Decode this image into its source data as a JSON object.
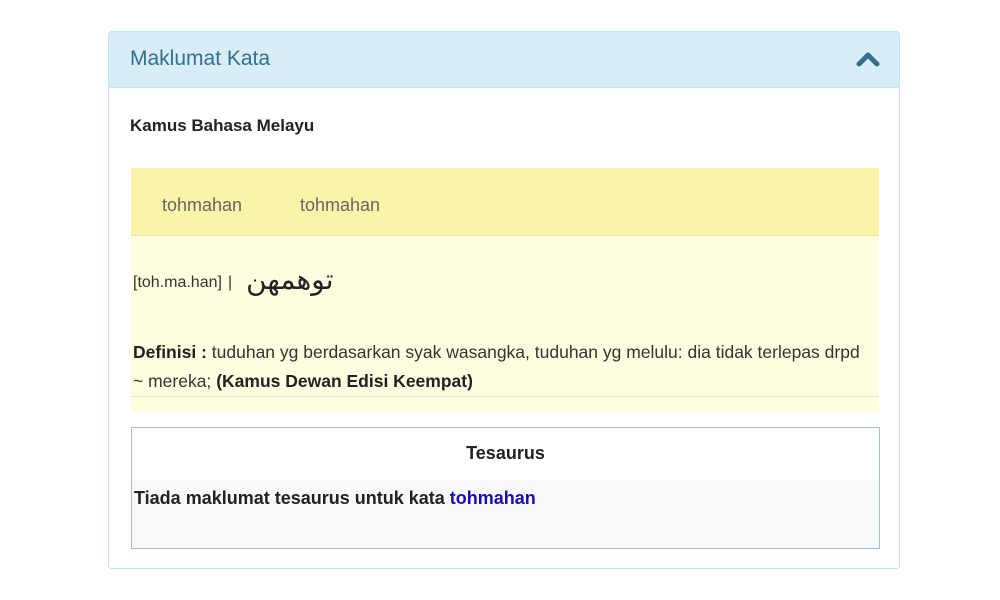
{
  "panel": {
    "title": "Maklumat Kata",
    "toggle_icon": "chevron-up-icon"
  },
  "dictionary": {
    "name": "Kamus Bahasa Melayu",
    "tabs": [
      {
        "label": "tohmahan"
      },
      {
        "label": "tohmahan"
      }
    ],
    "pronunciation": "[toh.ma.han]",
    "separator": "|",
    "jawi": "توهمهن",
    "definition_label": "Definisi :",
    "definition_text": "tuduhan yg berdasarkan syak wasangka, tuduhan yg melulu: dia tidak terlepas drpd ~ mereka;",
    "source": "(Kamus Dewan Edisi Keempat)"
  },
  "thesaurus": {
    "title": "Tesaurus",
    "message": "Tiada maklumat tesaurus untuk kata",
    "word": "tohmahan"
  },
  "colors": {
    "heading_bg": "#d9edf7",
    "heading_text": "#31708f",
    "tab_bar_bg": "#fbf4a8",
    "result_bg": "#fffde0",
    "link": "#1a0dab"
  }
}
